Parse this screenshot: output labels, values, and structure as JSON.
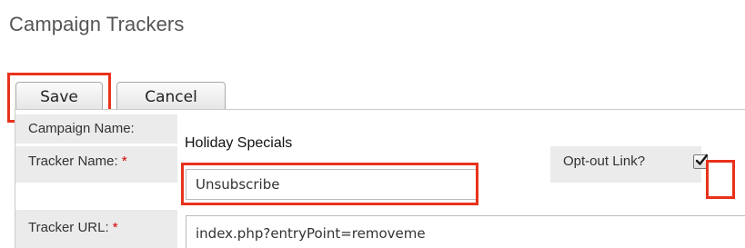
{
  "page": {
    "title": "Campaign Trackers"
  },
  "toolbar": {
    "save_label": "Save",
    "cancel_label": "Cancel"
  },
  "form": {
    "campaign_name": {
      "label": "Campaign Name:",
      "value": "Holiday Specials"
    },
    "tracker_name": {
      "label": "Tracker Name:",
      "required_marker": "*",
      "value": "Unsubscribe"
    },
    "opt_out": {
      "label": "Opt-out Link?",
      "checked": true
    },
    "tracker_url": {
      "label": "Tracker URL:",
      "required_marker": "*",
      "value": "index.php?entryPoint=removeme"
    }
  },
  "colors": {
    "highlight": "#e8321b",
    "label_background": "#ebebeb",
    "required": "#d40000"
  }
}
